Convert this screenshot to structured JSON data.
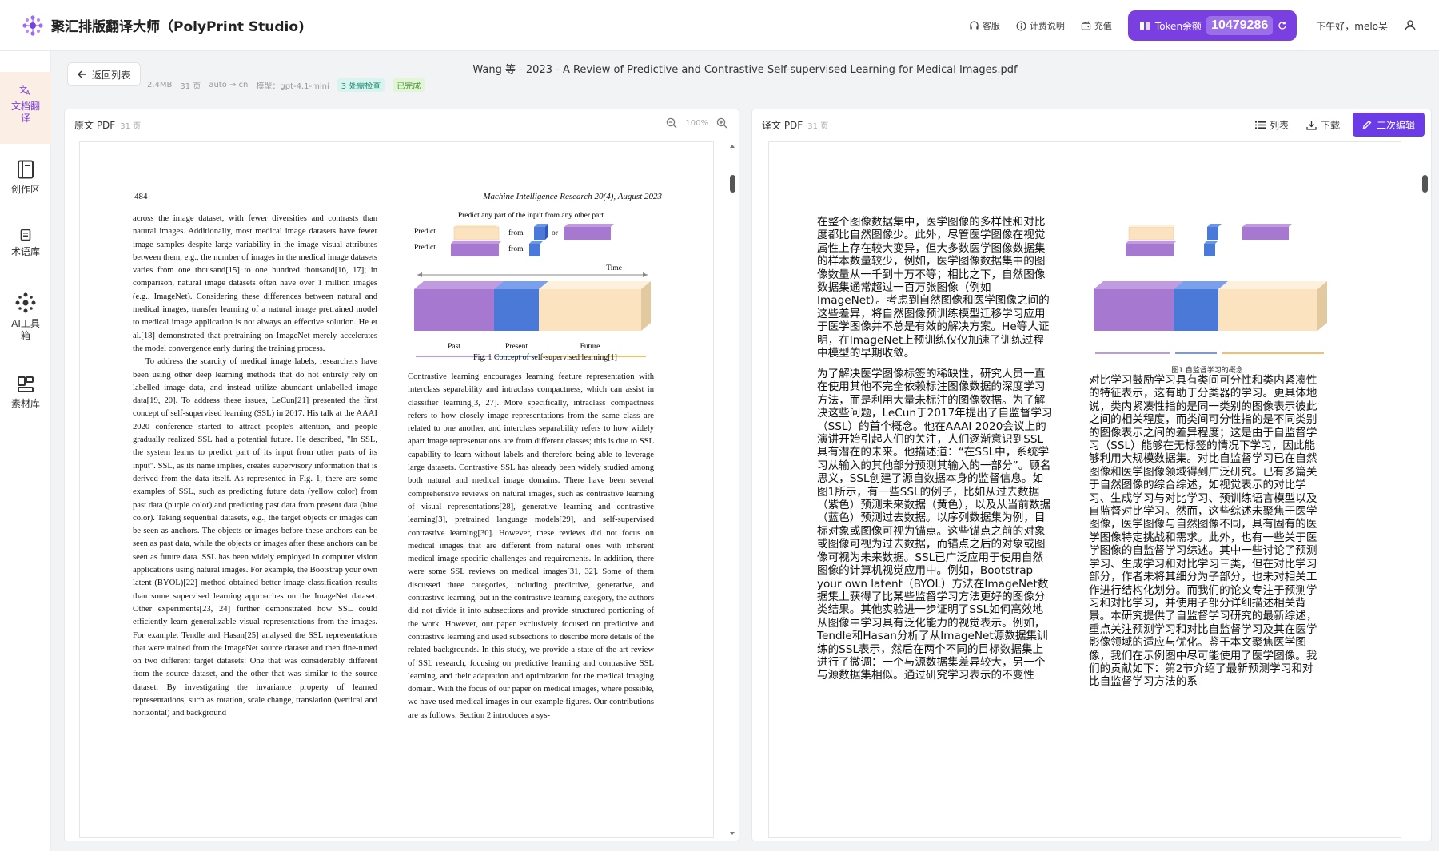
{
  "app": {
    "title": "聚汇排版翻译大师（PolyPrint Studio)",
    "accent": "#7a3fe0"
  },
  "header": {
    "support": "客服",
    "billing": "计费说明",
    "recharge": "充值",
    "token_label": "Token余额",
    "token_value": "10479286",
    "greeting": "下午好，melo吴"
  },
  "sidebar": {
    "items": [
      {
        "label": "文档翻译",
        "icon": "translate-icon",
        "active": true
      },
      {
        "label": "创作区",
        "icon": "book-icon"
      },
      {
        "label": "术语库",
        "icon": "glossary-icon"
      },
      {
        "label": "AI工具箱",
        "icon": "ai-tools-icon"
      },
      {
        "label": "素材库",
        "icon": "material-icon"
      }
    ]
  },
  "document": {
    "back_label": "返回列表",
    "title": "Wang 等 - 2023 - A Review of Predictive and Contrastive Self-supervised Learning for Medical Images.pdf",
    "size": "2.4MB",
    "pages": "31 页",
    "lang": "auto → cn",
    "model": "模型：gpt-4.1-mini",
    "check_badge": "3 处需检查",
    "status_badge": "已完成"
  },
  "left_panel": {
    "title": "原文 PDF",
    "pages": "31 页",
    "zoom": "100%"
  },
  "right_panel": {
    "title": "译文 PDF",
    "pages": "31 页",
    "list_label": "列表",
    "download_label": "下载",
    "edit_label": "二次编辑"
  },
  "en_page": {
    "page_number": "484",
    "journal": "Machine Intelligence Research 20(4), August 2023",
    "figure": {
      "title": "Predict any part of the input from any other part",
      "predict1": "Predict",
      "predict2": "Predict",
      "from1": "from",
      "from2": "from",
      "or": "or",
      "time": "Time",
      "past": "Past",
      "present": "Present",
      "future": "Future",
      "caption": "Fig. 1    Concept of self-supervised learning[1]"
    },
    "col1_p1": "across the image dataset, with fewer diversities and contrasts than natural images. Additionally, most medical image datasets have fewer image samples despite large variability in the image visual attributes between them, e.g., the number of images in the medical image datasets varies from one thousand[15] to one hundred thousand[16, 17]; in comparison, natural image datasets often have over 1 million images (e.g., ImageNet). Considering these differences between natural and medical images, transfer learning of a natural image pretrained model to medical image application is not always an effective solution. He et al.[18] demonstrated that pretraining on ImageNet merely accelerates the model convergence early during the training process.",
    "col1_p2": "To address the scarcity of medical image labels, researchers have been using other deep learning methods that do not entirely rely on labelled image data, and instead utilize abundant unlabelled image data[19, 20]. To address these issues, LeCun[21] presented the first concept of self-supervised learning (SSL) in 2017. His talk at the AAAI 2020 conference started to attract people's attention, and people gradually realized SSL had a potential future. He described, \"In SSL, the system learns to predict part of its input from other parts of its input\". SSL, as its name implies, creates supervisory information that is derived from the data itself. As represented in Fig. 1, there are some examples of SSL, such as predicting future data (yellow color) from past data (purple color) and predicting past data from present data (blue color). Taking sequential datasets, e.g., the target objects or images can be seen as anchors. The objects or images before these anchors can be seen as past data, while the objects or images after these anchors can be seen as future data. SSL has been widely employed in computer vision applications using natural images. For example, the Bootstrap your own latent (BYOL)[22] method obtained better image classification results than some supervised learning approaches on the ImageNet dataset. Other experiments[23, 24] further demonstrated how SSL could efficiently learn generalizable visual representations from the images. For example, Tendle and Hasan[25] analysed the SSL representations that were trained from the ImageNet source dataset and then fine-tuned on two different target datasets: One that was considerably different from the source dataset, and the other that was similar to the source dataset. By investigating the invariance property of learned representations, such as rotation, scale change, translation (vertical and horizontal) and background",
    "col2_p1": "Contrastive learning encourages learning feature representation with interclass separability and intraclass compactness, which can assist in classifier learning[3, 27]. More specifically, intraclass compactness refers to how closely image representations from the same class are related to one another, and interclass separability refers to how widely apart image representations are from different classes; this is due to SSL capability to learn without labels and therefore being able to leverage large datasets. Contrastive SSL has already been widely studied among both natural and medical image domains. There have been several comprehensive reviews on natural images, such as contrastive learning of visual representations[28], generative learning and contrastive learning[3], pretrained language models[29], and self-supervised contrastive learning[30]. However, these reviews did not focus on medical images that are different from natural ones with inherent medical image specific challenges and requirements. In addition, there were some SSL reviews on medical images[31, 32]. Some of them discussed three categories, including predictive, generative, and contrastive learning, but in the contrastive learning category, the authors did not divide it into subsections and provide structured portioning of the work. However, our paper exclusively focused on predictive and contrastive learning and used subsections to describe more details of the related backgrounds. In this study, we provide a state-of-the-art review of SSL research, focusing on predictive learning and contrastive SSL learning, and their adaptation and optimization for the medical imaging domain. With the focus of our paper on medical images, where possible, we have used medical images in our example figures. Our contributions are as follows: Section 2 introduces a sys-"
  },
  "zh_page": {
    "figure_caption": "图1 自监督学习的概念",
    "col1": "在整个图像数据集中，医学图像的多样性和对比度都比自然图像少。此外，尽管医学图像在视觉属性上存在较大变异，但大多数医学图像数据集的样本数量较少，例如，医学图像数据集中的图像数量从一千到十万不等；相比之下，自然图像数据集通常超过一百万张图像（例如ImageNet）。考虑到自然图像和医学图像之间的这些差异，将自然图像预训练模型迁移学习应用于医学图像并不总是有效的解决方案。He等人证明，在ImageNet上预训练仅仅加速了训练过程中模型的早期收敛。",
    "col2": "为了解决医学图像标签的稀缺性，研究人员一直在使用其他不完全依赖标注图像数据的深度学习方法，而是利用大量未标注的图像数据。为了解决这些问题，LeCun于2017年提出了自监督学习（SSL）的首个概念。他在AAAI 2020会议上的演讲开始引起人们的关注，人们逐渐意识到SSL具有潜在的未来。他描述道：“在SSL中，系统学习从输入的其他部分预测其输入的一部分”。顾名思义，SSL创建了源自数据本身的监督信息。如图1所示，有一些SSL的例子，比如从过去数据（紫色）预测未来数据（黄色），以及从当前数据（蓝色）预测过去数据。以序列数据集为例，目标对象或图像可视为锚点。这些锚点之前的对象或图像可视为过去数据，而锚点之后的对象或图像可视为未来数据。SSL已广泛应用于使用自然图像的计算机视觉应用中。例如，Bootstrap your own latent（BYOL）方法在ImageNet数据集上获得了比某些监督学习方法更好的图像分类结果。其他实验进一步证明了SSL如何高效地从图像中学习具有泛化能力的视觉表示。例如，Tendle和Hasan分析了从ImageNet源数据集训练的SSL表示，然后在两个不同的目标数据集上进行了微调：一个与源数据集差异较大，另一个与源数据集相似。通过研究学习表示的不变性",
    "col3": "对比学习鼓励学习具有类间可分性和类内紧凑性的特征表示，这有助于分类器的学习。更具体地说，类内紧凑性指的是同一类别的图像表示彼此之间的相关程度，而类间可分性指的是不同类别的图像表示之间的差异程度；这是由于自监督学习（SSL）能够在无标签的情况下学习，因此能够利用大规模数据集。对比自监督学习已在自然图像和医学图像领域得到广泛研究。已有多篇关于自然图像的综合综述，如视觉表示的对比学习、生成学习与对比学习、预训练语言模型以及自监督对比学习。然而，这些综述未聚焦于医学图像，医学图像与自然图像不同，具有固有的医学图像特定挑战和需求。此外，也有一些关于医学图像的自监督学习综述。其中一些讨论了预测学习、生成学习和对比学习三类，但在对比学习部分，作者未将其细分为子部分，也未对相关工作进行结构化划分。而我们的论文专注于预测学习和对比学习，并使用子部分详细描述相关背景。本研究提供了自监督学习研究的最新综述，重点关注预测学习和对比自监督学习及其在医学影像领域的适应与优化。鉴于本文聚焦医学图像，我们在示例图中尽可能使用了医学图像。我们的贡献如下：第2节介绍了最新预测学习和对比自监督学习方法的系"
  }
}
